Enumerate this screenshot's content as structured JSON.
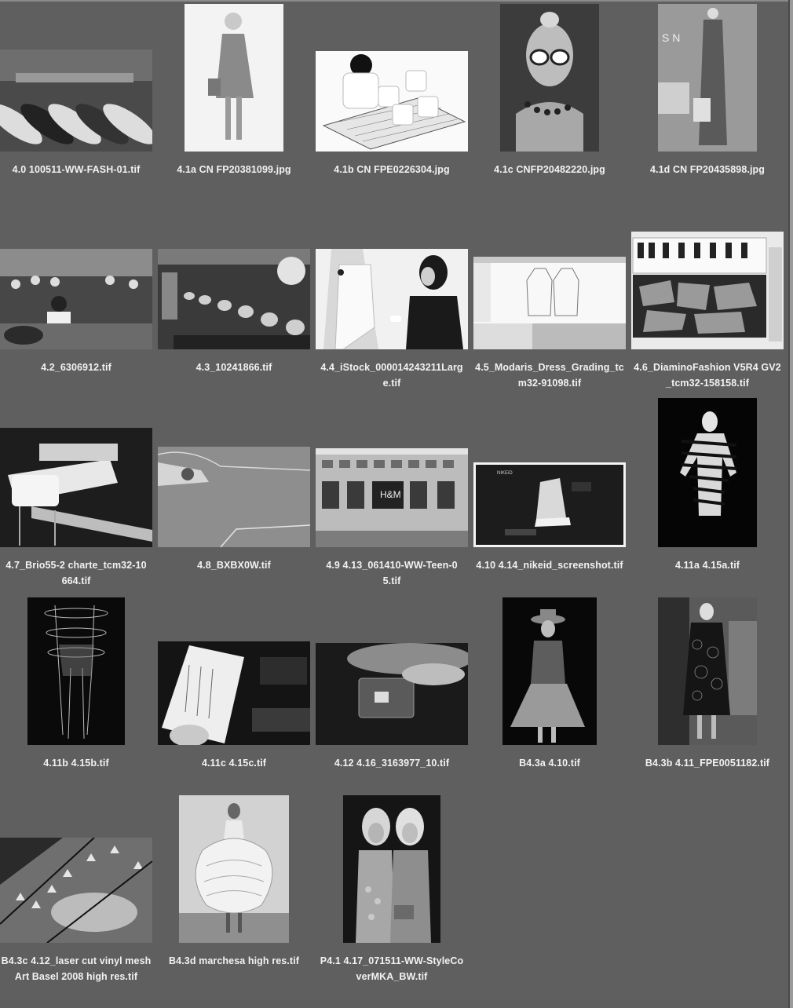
{
  "window": {
    "background": "#5f5f5f",
    "caption_color": "#f2f2f2"
  },
  "files": [
    {
      "name": "4.0 100511-WW-FASH-01.tif",
      "icon": "factory-photo-thumbnail"
    },
    {
      "name": "4.1a CN FP20381099.jpg",
      "icon": "model-coat-thumbnail"
    },
    {
      "name": "4.1b CN FPE0226304.jpg",
      "icon": "tea-set-thumbnail"
    },
    {
      "name": "4.1c CNFP20482220.jpg",
      "icon": "sunglasses-portrait-thumbnail"
    },
    {
      "name": "4.1d CN FP20435898.jpg",
      "icon": "runway-model-thumbnail"
    },
    {
      "name": "4.2_6306912.tif",
      "icon": "sewing-workers-thumbnail"
    },
    {
      "name": "4.3_10241866.tif",
      "icon": "textile-machine-thumbnail"
    },
    {
      "name": "4.4_iStock_000014243211Large.tif",
      "icon": "designer-mannequin-thumbnail"
    },
    {
      "name": "4.5_Modaris_Dress_Grading_tcm32-91098.tif",
      "icon": "pattern-software-thumbnail"
    },
    {
      "name": "4.6_DiaminoFashion V5R4 GV2_tcm32-158158.tif",
      "icon": "marker-software-thumbnail"
    },
    {
      "name": "4.7_Brio55-2 charte_tcm32-10664.tif",
      "icon": "spreading-machine-thumbnail"
    },
    {
      "name": "4.8_BXBX0W.tif",
      "icon": "cutting-tool-thumbnail"
    },
    {
      "name": "4.9 4.13_061410-WW-Teen-05.tif",
      "icon": "store-front-thumbnail"
    },
    {
      "name": "4.10 4.14_nikeid_screenshot.tif",
      "icon": "sneaker-screenshot-thumbnail"
    },
    {
      "name": "4.11a 4.15a.tif",
      "icon": "striped-figure-thumbnail"
    },
    {
      "name": "4.11b 4.15b.tif",
      "icon": "wire-figure-thumbnail"
    },
    {
      "name": "4.11c 4.15c.tif",
      "icon": "sketch-card-thumbnail"
    },
    {
      "name": "4.12 4.16_3163977_10.tif",
      "icon": "rfid-chip-thumbnail"
    },
    {
      "name": "B4.3a 4.10.tif",
      "icon": "feather-dress-thumbnail"
    },
    {
      "name": "B4.3b 4.11_FPE0051182.tif",
      "icon": "lace-dress-thumbnail"
    },
    {
      "name": "B4.3c 4.12_laser cut vinyl mesh Art Basel 2008 high res.tif",
      "icon": "laser-mesh-thumbnail"
    },
    {
      "name": "B4.3d marchesa high res.tif",
      "icon": "ruffle-gown-thumbnail"
    },
    {
      "name": "P4.1 4.17_071511-WW-StyleCoverMKA_BW.tif",
      "icon": "two-women-thumbnail"
    }
  ],
  "captions": [
    "4.0 100511-WW-FASH-01.tif",
    "4.1a CN FP20381099.jpg",
    "4.1b CN FPE0226304.jpg",
    "4.1c CNFP20482220.jpg",
    "4.1d CN FP20435898.jpg",
    "4.2_6306912.tif",
    "4.3_10241866.tif",
    "4.4_iStock_000014243211Larg\ne.tif",
    "4.5_Modaris_Dress_Grading_tc\nm32-91098.tif",
    "4.6_DiaminoFashion V5R4 GV2\n_tcm32-158158.tif",
    "4.7_Brio55-2 charte_tcm32-10\n664.tif",
    "4.8_BXBX0W.tif",
    "4.9 4.13_061410-WW-Teen-0\n5.tif",
    "4.10 4.14_nikeid_screenshot.tif",
    "4.11a 4.15a.tif",
    "4.11b 4.15b.tif",
    "4.11c 4.15c.tif",
    "4.12 4.16_3163977_10.tif",
    "B4.3a 4.10.tif",
    "B4.3b 4.11_FPE0051182.tif",
    "B4.3c 4.12_laser cut vinyl mesh\nArt Basel 2008 high res.tif",
    "B4.3d marchesa high res.tif",
    "P4.1 4.17_071511-WW-StyleCo\nverMKA_BW.tif"
  ]
}
